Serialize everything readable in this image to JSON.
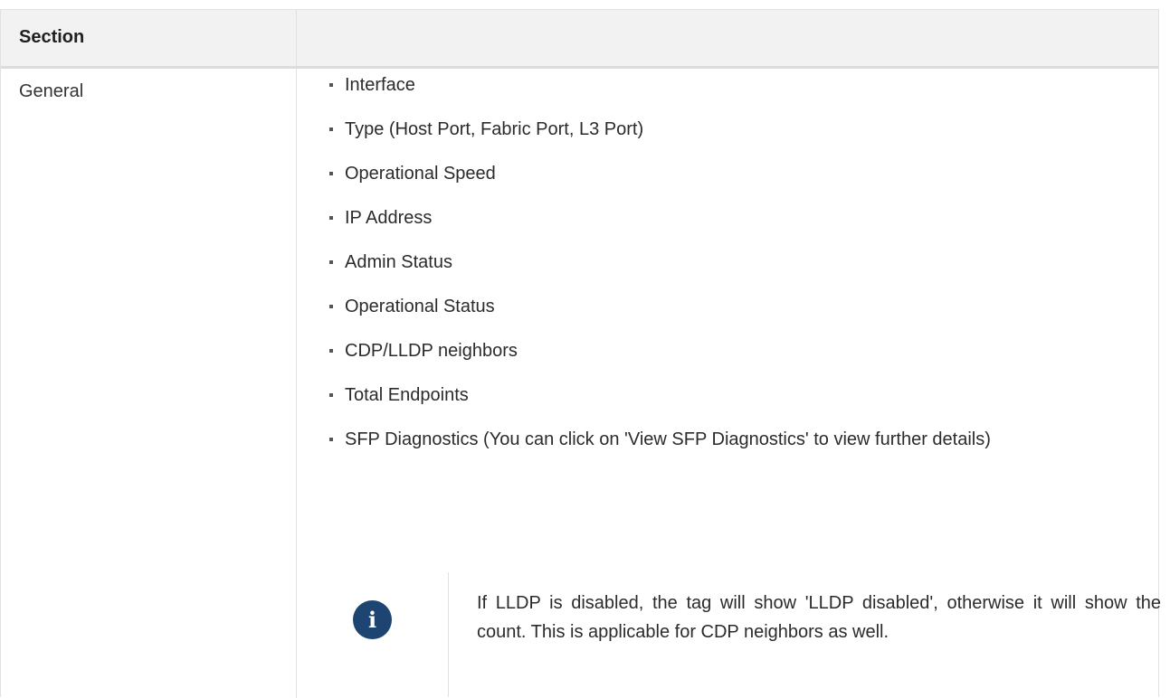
{
  "table": {
    "header": {
      "section_label": "Section",
      "detail_label": ""
    },
    "rows": [
      {
        "section": "General",
        "items": [
          "Interface",
          "Type (Host Port, Fabric Port, L3 Port)",
          "Operational Speed",
          "IP Address",
          "Admin Status",
          "Operational Status",
          "CDP/LLDP neighbors",
          "Total Endpoints",
          "SFP Diagnostics (You can click on 'View SFP Diagnostics' to view further details)"
        ],
        "note": {
          "icon": "info-icon",
          "icon_glyph": "i",
          "text": "If LLDP is disabled, the tag will show 'LLDP disabled', otherwise it will show the count. This is applicable for CDP neighbors as well."
        }
      }
    ]
  },
  "colors": {
    "header_bg": "#f2f2f2",
    "note_icon_bg": "#1e4471",
    "border": "#e1e1e1"
  }
}
